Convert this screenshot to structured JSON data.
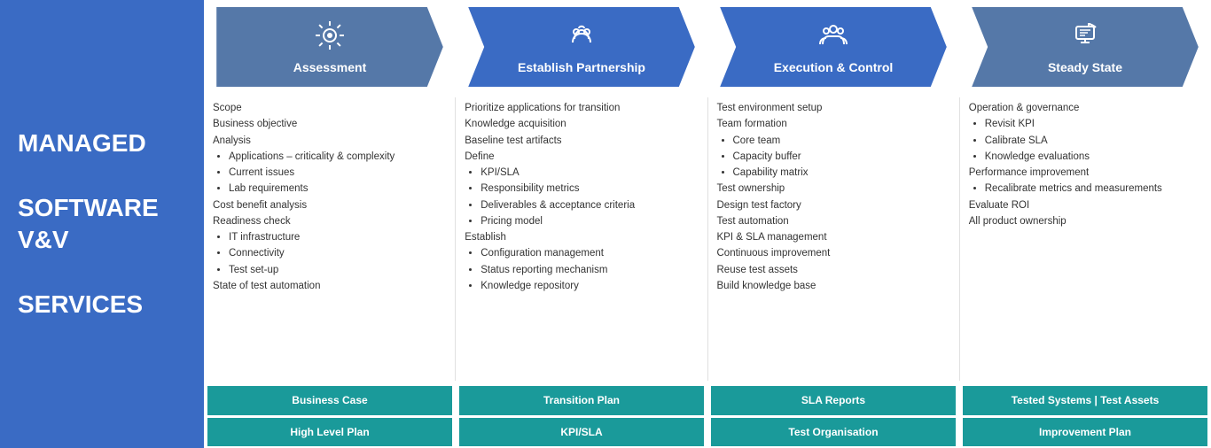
{
  "sidebar": {
    "title": "MANAGED\n\nSOFTWARE V&V\n\nSERVICES"
  },
  "phases": [
    {
      "id": "assessment",
      "label": "Assessment",
      "icon": "⚙",
      "arrowClass": "first assessment",
      "content": [
        {
          "type": "text",
          "text": "Scope"
        },
        {
          "type": "text",
          "text": "Business objective"
        },
        {
          "type": "text",
          "text": "Analysis"
        },
        {
          "type": "bullets",
          "items": [
            "Applications – criticality & complexity",
            "Current issues",
            "Lab requirements"
          ]
        },
        {
          "type": "text",
          "text": "Cost benefit analysis"
        },
        {
          "type": "text",
          "text": "Readiness check"
        },
        {
          "type": "bullets",
          "items": [
            "IT infrastructure",
            "Connectivity",
            "Test set-up"
          ]
        },
        {
          "type": "text",
          "text": "State of test automation"
        }
      ],
      "deliverables": [
        "Business Case",
        "High Level Plan"
      ]
    },
    {
      "id": "establish",
      "label": "Establish Partnership",
      "icon": "🤝",
      "arrowClass": "establish",
      "content": [
        {
          "type": "text",
          "text": "Prioritize applications for transition"
        },
        {
          "type": "text",
          "text": "Knowledge acquisition"
        },
        {
          "type": "text",
          "text": "Baseline test artifacts"
        },
        {
          "type": "text",
          "text": "Define"
        },
        {
          "type": "bullets",
          "items": [
            "KPI/SLA",
            "Responsibility metrics",
            "Deliverables & acceptance criteria",
            "Pricing model"
          ]
        },
        {
          "type": "text",
          "text": "Establish"
        },
        {
          "type": "bullets",
          "items": [
            "Configuration management",
            "Status reporting mechanism",
            "Knowledge repository"
          ]
        }
      ],
      "deliverables": [
        "Transition Plan",
        "KPI/SLA"
      ]
    },
    {
      "id": "execution",
      "label": "Execution & Control",
      "icon": "👥",
      "arrowClass": "execution",
      "content": [
        {
          "type": "text",
          "text": "Test environment setup"
        },
        {
          "type": "text",
          "text": "Team formation"
        },
        {
          "type": "bullets",
          "items": [
            "Core team",
            "Capacity buffer",
            "Capability matrix"
          ]
        },
        {
          "type": "text",
          "text": "Test ownership"
        },
        {
          "type": "text",
          "text": "Design test factory"
        },
        {
          "type": "text",
          "text": "Test automation"
        },
        {
          "type": "text",
          "text": "KPI & SLA management"
        },
        {
          "type": "text",
          "text": "Continuous improvement"
        },
        {
          "type": "text",
          "text": "Reuse test assets"
        },
        {
          "type": "text",
          "text": "Build knowledge base"
        }
      ],
      "deliverables": [
        "SLA Reports",
        "Test Organisation"
      ]
    },
    {
      "id": "steady",
      "label": "Steady State",
      "icon": "🖥",
      "arrowClass": "steady",
      "content": [
        {
          "type": "text",
          "text": "Operation & governance"
        },
        {
          "type": "bullets",
          "items": [
            "Revisit KPI",
            "Calibrate SLA",
            "Knowledge evaluations"
          ]
        },
        {
          "type": "text",
          "text": "Performance improvement"
        },
        {
          "type": "bullets",
          "items": [
            "Recalibrate metrics and measurements"
          ]
        },
        {
          "type": "text",
          "text": "Evaluate ROI"
        },
        {
          "type": "text",
          "text": "All product ownership"
        }
      ],
      "deliverables": [
        "Tested Systems | Test Assets",
        "Improvement Plan"
      ]
    }
  ]
}
